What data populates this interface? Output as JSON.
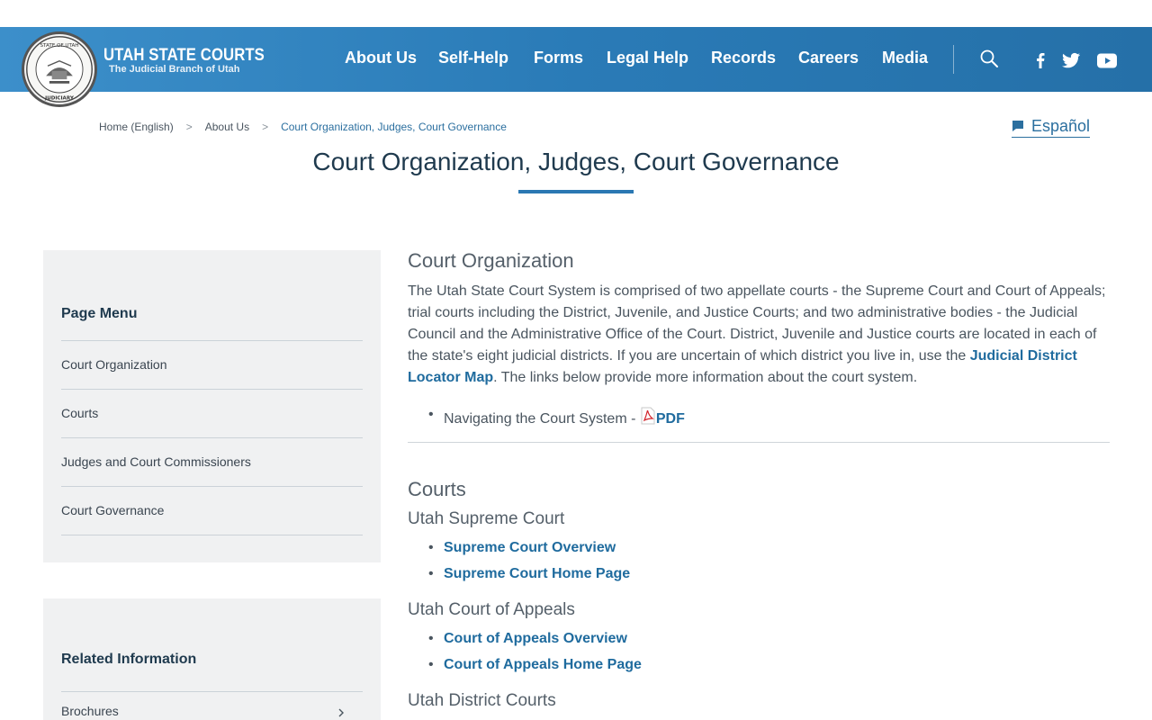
{
  "header": {
    "brand_title": "UTAH STATE COURTS",
    "brand_subtitle": "The Judicial Branch of Utah",
    "seal_top_text": "STATE OF UTAH",
    "seal_bottom_text": "JUDICIARY",
    "nav": [
      {
        "label": "About Us"
      },
      {
        "label": "Self-Help"
      },
      {
        "label": "Forms"
      },
      {
        "label": "Legal Help"
      },
      {
        "label": "Records"
      },
      {
        "label": "Careers"
      },
      {
        "label": "Media"
      }
    ],
    "icons": [
      "search-icon",
      "facebook-icon",
      "twitter-icon",
      "youtube-icon"
    ]
  },
  "breadcrumb": {
    "home": "Home (English)",
    "parent": "About Us",
    "current": "Court Organization, Judges, Court Governance",
    "separator": ">"
  },
  "language_link": "Español",
  "page_title": "Court Organization, Judges, Court Governance",
  "sidebar": {
    "page_menu": {
      "heading": "Page Menu",
      "items": [
        {
          "label": "Court Organization"
        },
        {
          "label": "Courts"
        },
        {
          "label": "Judges and Court Commissioners"
        },
        {
          "label": "Court Governance"
        }
      ]
    },
    "related": {
      "heading": "Related Information",
      "items": [
        {
          "label": "Brochures"
        }
      ]
    }
  },
  "content": {
    "org_heading": "Court Organization",
    "org_paragraph_1": "The Utah State Court System is comprised of two appellate courts - the Supreme Court and Court of Appeals; trial courts including the District, Juvenile, and Justice Courts; and two administrative bodies - the Judicial Council and the Administrative Office of the Court. District, Juvenile and Justice courts are located in each of the state's eight judicial districts. If you are uncertain of which district you live in, use the ",
    "org_link": "Judicial District Locator Map",
    "org_paragraph_2": ". The links below provide more information about the court system.",
    "nav_bullet_text": "Navigating the Court System - ",
    "nav_bullet_link": "PDF",
    "courts_heading": "Courts",
    "supreme_heading": "Utah Supreme Court",
    "supreme_links": [
      "Supreme Court Overview",
      "Supreme Court Home Page"
    ],
    "appeals_heading": "Utah Court of Appeals",
    "appeals_links": [
      "Court of Appeals Overview",
      "Court of Appeals Home Page"
    ],
    "district_heading": "Utah District Courts"
  },
  "colors": {
    "header_blue": "#2a7bb7",
    "link_blue": "#1f6b9e",
    "title_navy": "#1f3a4e",
    "panel_gray": "#f0f1f2"
  }
}
